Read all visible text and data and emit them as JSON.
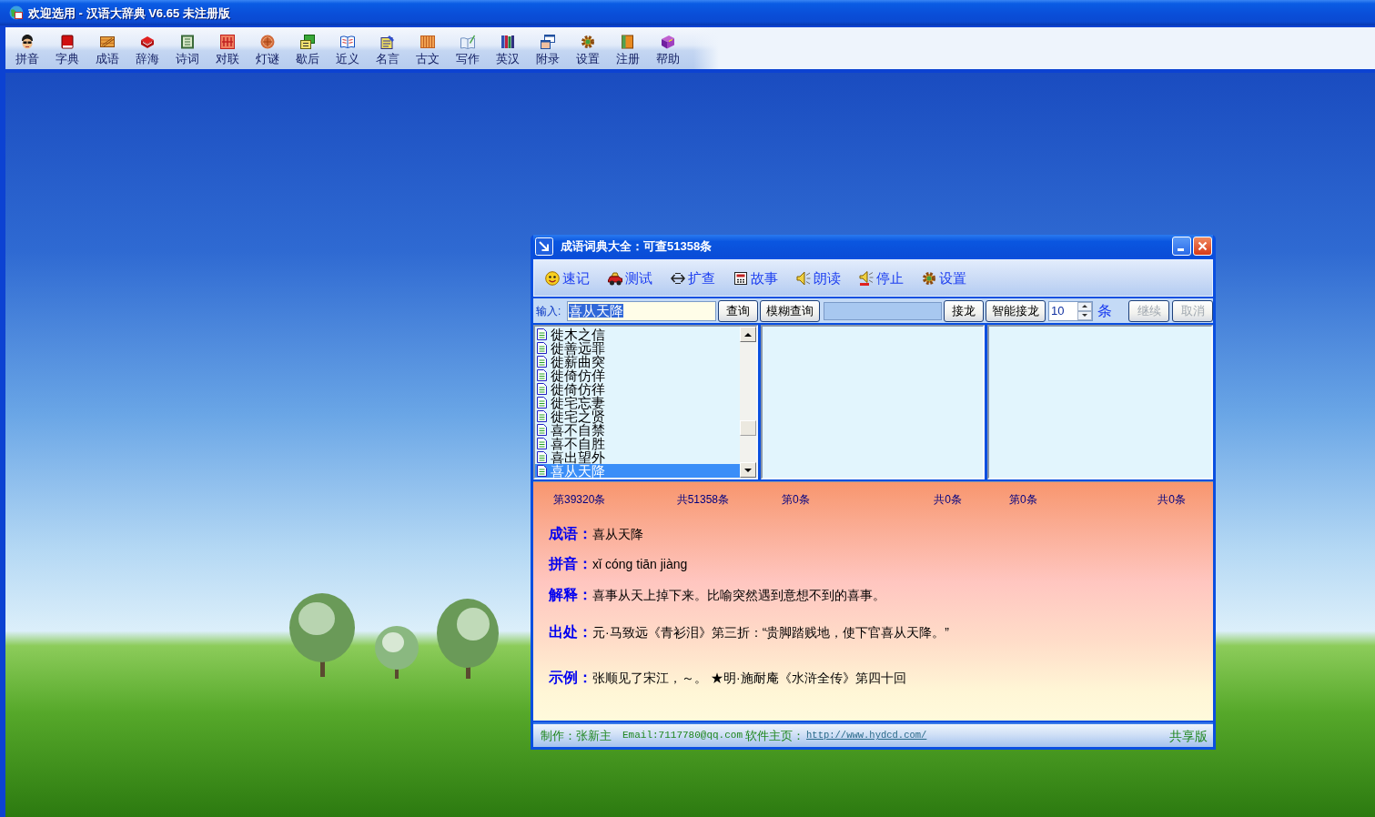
{
  "window": {
    "title": "欢迎选用 - 汉语大辞典 V6.65 未注册版"
  },
  "toolbar": [
    "拼音",
    "字典",
    "成语",
    "辞海",
    "诗词",
    "对联",
    "灯谜",
    "歇后",
    "近义",
    "名言",
    "古文",
    "写作",
    "英汉",
    "附录",
    "设置",
    "注册",
    "帮助"
  ],
  "dialog": {
    "title": "成语词典大全：可查51358条",
    "toolbar": [
      "速记",
      "测试",
      "扩查",
      "故事",
      "朗读",
      "停止",
      "设置"
    ],
    "input_row": {
      "label": "输入:",
      "query": {
        "value": "喜从天降",
        "text_selected": true
      },
      "buttons": [
        {
          "label": "查询",
          "disabled": false
        },
        {
          "label": "模糊查询",
          "disabled": false
        }
      ],
      "chain_buttons": [
        {
          "label": "接龙",
          "disabled": false
        },
        {
          "label": "智能接龙",
          "disabled": false
        }
      ],
      "count": "10",
      "count_unit": "条",
      "control_buttons": [
        {
          "label": "继续",
          "disabled": true
        },
        {
          "label": "取消",
          "disabled": true
        }
      ]
    },
    "list": [
      {
        "text": "徙木之信",
        "selected": false
      },
      {
        "text": "徙善远罪",
        "selected": false
      },
      {
        "text": "徙薪曲突",
        "selected": false
      },
      {
        "text": "徙倚仿佯",
        "selected": false
      },
      {
        "text": "徙倚仿徉",
        "selected": false
      },
      {
        "text": "徙宅忘妻",
        "selected": false
      },
      {
        "text": "徙宅之贤",
        "selected": false
      },
      {
        "text": "喜不自禁",
        "selected": false
      },
      {
        "text": "喜不自胜",
        "selected": false
      },
      {
        "text": "喜出望外",
        "selected": false
      },
      {
        "text": "喜从天降",
        "selected": true
      }
    ],
    "stats": [
      {
        "current": "第39320条",
        "total": "共51358条"
      },
      {
        "current": "第0条",
        "total": "共0条"
      },
      {
        "current": "第0条",
        "total": "共0条"
      }
    ],
    "fields": [
      {
        "label": "成语：",
        "value": "喜从天降"
      },
      {
        "label": "拼音：",
        "value": "xǐ cóng tiān jiàng"
      },
      {
        "label": "解释：",
        "value": "喜事从天上掉下来。比喻突然遇到意想不到的喜事。"
      },
      {
        "label": "出处：",
        "value": "元·马致远《青衫泪》第三折：“贵脚踏贱地，使下官喜从天降。”"
      },
      {
        "label": "示例：",
        "value": "张顺见了宋江，～。 ★明·施耐庵《水浒全传》第四十回"
      }
    ],
    "footer": {
      "author": "制作：张新主",
      "email": "Email:7117780@qq.com",
      "homepage_label": "软件主页：",
      "homepage_link": "http://www.hydcd.com/",
      "edition": "共享版"
    }
  }
}
